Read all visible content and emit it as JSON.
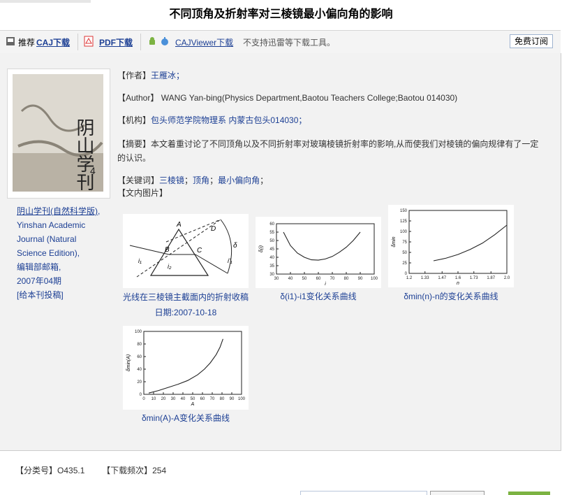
{
  "title": "不同顶角及折射率对三棱镜最小偏向角的影响",
  "toolbar": {
    "recommend": "推荐",
    "caj": "CAJ下载",
    "pdf": "PDF下载",
    "viewer": "CAJViewer下载",
    "note": "不支持迅雷等下载工具。",
    "free": "免费订阅"
  },
  "journal": {
    "name": "阴山学刊(自然科学版)",
    "en": ", Yinshan Academic Journal (Natural Science Edition),",
    "editor": "编辑部邮箱,",
    "issue": "2007年04期",
    "submit": "[给本刊投稿]",
    "cover_title": "阴山学刊",
    "cover_issue": "4"
  },
  "meta": {
    "author_label": "【作者】",
    "author": "王雁冰；",
    "author_en_label": "【Author】",
    "author_en": "WANG Yan-bing(Physics Department,Baotou Teachers College;Baotou 014030)",
    "org_label": "【机构】",
    "org": "包头师范学院物理系 内蒙古包头014030；",
    "abstract_label": "【摘要】",
    "abstract": "本文着重讨论了不同顶角以及不同折射率对玻璃棱镜折射率的影响,从而使我们对棱镜的偏向规律有了一定的认识。",
    "keywords_label": "【关键词】",
    "kw1": "三棱镜",
    "kw2": "顶角",
    "kw3": "最小偏向角",
    "figs_label": "【文内图片】"
  },
  "figures": {
    "f1_caption": "光线在三棱镜主截面内的折射收稿日期:2007-10-18",
    "f1_cap_line1": "光线在三棱镜主截面内的折射收稿",
    "f1_cap_line2": "日期:2007-10-18",
    "f2_caption": "δ(i1)-i1变化关系曲线",
    "f3_caption": "δmin(n)-n的变化关系曲线",
    "f4_caption": "δmin(A)-A变化关系曲线"
  },
  "footer": {
    "class_label": "【分类号】",
    "class": "O435.1",
    "dl_label": "【下载频次】",
    "dl": "254"
  },
  "colors": {
    "link": "#1c3f94",
    "panel": "#f2f2f2"
  },
  "chart_data": [
    {
      "type": "line",
      "name_ref": "f2",
      "xlabel": "i",
      "ylabel": "δ(i)",
      "xticks": [
        "30",
        "40",
        "50",
        "60",
        "70",
        "80",
        "90",
        "100"
      ],
      "yticks": [
        "30",
        "35",
        "40",
        "45",
        "50",
        "55",
        "60"
      ],
      "xlim": [
        30,
        100
      ],
      "ylim": [
        30,
        60
      ],
      "x": [
        35,
        40,
        45,
        50,
        55,
        60,
        65,
        70,
        75,
        80,
        85,
        90
      ],
      "y": [
        55,
        47,
        42.5,
        40,
        38.5,
        38.3,
        39,
        40.5,
        43,
        46,
        50,
        55
      ]
    },
    {
      "type": "line",
      "name_ref": "f3",
      "xlabel": "n",
      "ylabel": "δmin",
      "xticks": [
        "1.2",
        "1.33",
        "1.47",
        "1.6",
        "1.73",
        "1.87",
        "2.0"
      ],
      "yticks": [
        "0",
        "25",
        "50",
        "75",
        "100",
        "125",
        "150"
      ],
      "xlim": [
        1.2,
        2.0
      ],
      "ylim": [
        0,
        150
      ],
      "x": [
        1.4,
        1.5,
        1.6,
        1.7,
        1.8,
        1.9,
        2.0
      ],
      "y": [
        30,
        36,
        45,
        57,
        72,
        92,
        115
      ]
    },
    {
      "type": "line",
      "name_ref": "f4",
      "xlabel": "A",
      "ylabel": "δmin(A)",
      "xticks": [
        "0",
        "10",
        "20",
        "30",
        "40",
        "50",
        "60",
        "70",
        "80",
        "90",
        "100"
      ],
      "yticks": [
        "0",
        "20",
        "40",
        "60",
        "80",
        "100"
      ],
      "xlim": [
        0,
        100
      ],
      "ylim": [
        0,
        100
      ],
      "x": [
        5,
        15,
        25,
        35,
        45,
        55,
        62,
        68,
        74,
        78,
        81
      ],
      "y": [
        2,
        6,
        11,
        16,
        22,
        31,
        40,
        50,
        63,
        75,
        88
      ]
    }
  ]
}
